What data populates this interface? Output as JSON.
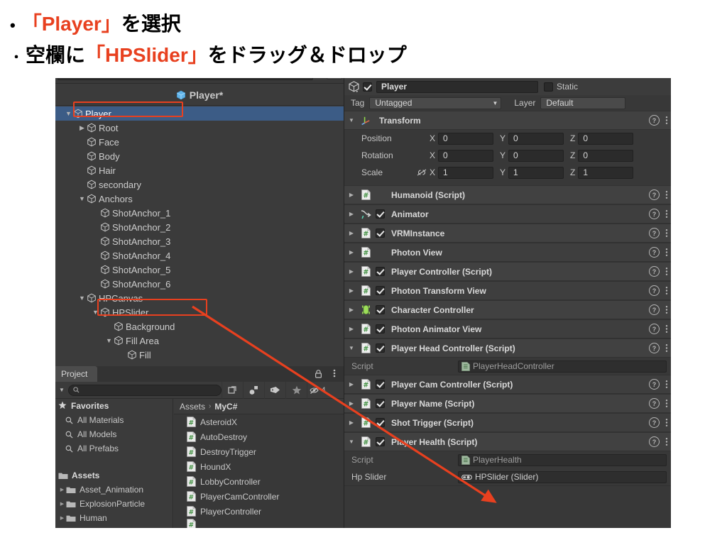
{
  "slide": {
    "line1": {
      "bullet": "•",
      "quote_open": "「",
      "highlight": "Player",
      "quote_close": "」",
      "rest": "を選択"
    },
    "line2": {
      "bullet": "・",
      "prefix": "空欄に",
      "quote_open": "「",
      "highlight": "HPSlider",
      "quote_close": "」",
      "rest": "をドラッグ＆ドロップ"
    },
    "highlight_color": "#e8401f",
    "text_color": "#000000"
  },
  "hierarchy": {
    "prefab_header": "Player*",
    "items": [
      {
        "label": "Player",
        "depth": 0,
        "twirl": "down",
        "selected": true
      },
      {
        "label": "Root",
        "depth": 1,
        "twirl": "right",
        "selected": false
      },
      {
        "label": "Face",
        "depth": 1,
        "twirl": "none",
        "selected": false
      },
      {
        "label": "Body",
        "depth": 1,
        "twirl": "none",
        "selected": false
      },
      {
        "label": "Hair",
        "depth": 1,
        "twirl": "none",
        "selected": false
      },
      {
        "label": "secondary",
        "depth": 1,
        "twirl": "none",
        "selected": false
      },
      {
        "label": "Anchors",
        "depth": 1,
        "twirl": "down",
        "selected": false
      },
      {
        "label": "ShotAnchor_1",
        "depth": 2,
        "twirl": "none",
        "selected": false
      },
      {
        "label": "ShotAnchor_2",
        "depth": 2,
        "twirl": "none",
        "selected": false
      },
      {
        "label": "ShotAnchor_3",
        "depth": 2,
        "twirl": "none",
        "selected": false
      },
      {
        "label": "ShotAnchor_4",
        "depth": 2,
        "twirl": "none",
        "selected": false
      },
      {
        "label": "ShotAnchor_5",
        "depth": 2,
        "twirl": "none",
        "selected": false
      },
      {
        "label": "ShotAnchor_6",
        "depth": 2,
        "twirl": "none",
        "selected": false
      },
      {
        "label": "HPCanvas",
        "depth": 1,
        "twirl": "down",
        "selected": false
      },
      {
        "label": "HPSlider",
        "depth": 2,
        "twirl": "down",
        "selected": false
      },
      {
        "label": "Background",
        "depth": 3,
        "twirl": "none",
        "selected": false
      },
      {
        "label": "Fill Area",
        "depth": 3,
        "twirl": "down",
        "selected": false
      },
      {
        "label": "Fill",
        "depth": 4,
        "twirl": "none",
        "selected": false
      }
    ],
    "selection_color": "#3c5c86"
  },
  "project": {
    "tab_label": "Project",
    "lock_icon": "lock-icon",
    "kebab_icon": "kebab-menu-icon",
    "search_placeholder": "",
    "search_value": "",
    "toolbar_icons": [
      "search-expand-icon",
      "asset-type-filter-icon",
      "label-filter-icon",
      "favorite-star-icon",
      "hidden-packages-icon"
    ],
    "toolbar_count": "4",
    "favorites": {
      "header": "Favorites",
      "items": [
        "All Materials",
        "All Models",
        "All Prefabs"
      ]
    },
    "assets": {
      "header": "Assets",
      "items": [
        "Asset_Animation",
        "ExplosionParticle",
        "Human"
      ]
    },
    "breadcrumb": {
      "root": "Assets",
      "sep": "›",
      "current": "MyC#"
    },
    "files": [
      "AsteroidX",
      "AutoDestroy",
      "DestroyTrigger",
      "HoundX",
      "LobbyController",
      "PlayerCamController",
      "PlayerController"
    ]
  },
  "inspector": {
    "object_name": "Player",
    "object_enabled": true,
    "static_label": "Static",
    "static_checked": false,
    "tag_label": "Tag",
    "tag_value": "Untagged",
    "layer_label": "Layer",
    "layer_value": "Default",
    "transform": {
      "title": "Transform",
      "rows": [
        {
          "label": "Position",
          "x": "0",
          "y": "0",
          "z": "0",
          "link": false
        },
        {
          "label": "Rotation",
          "x": "0",
          "y": "0",
          "z": "0",
          "link": false
        },
        {
          "label": "Scale",
          "x": "1",
          "y": "1",
          "z": "1",
          "link": true
        }
      ],
      "axes": [
        "X",
        "Y",
        "Z"
      ]
    },
    "components": [
      {
        "title": "Humanoid (Script)",
        "icon": "script-icon",
        "has_checkbox": false,
        "checked": false,
        "expanded": false
      },
      {
        "title": "Animator",
        "icon": "animator-icon",
        "has_checkbox": true,
        "checked": true,
        "expanded": false
      },
      {
        "title": "VRMInstance",
        "icon": "script-icon",
        "has_checkbox": true,
        "checked": true,
        "expanded": false
      },
      {
        "title": "Photon View",
        "icon": "script-icon",
        "has_checkbox": false,
        "checked": false,
        "expanded": false
      },
      {
        "title": "Player Controller (Script)",
        "icon": "script-icon",
        "has_checkbox": true,
        "checked": true,
        "expanded": false
      },
      {
        "title": "Photon Transform View",
        "icon": "script-icon",
        "has_checkbox": true,
        "checked": true,
        "expanded": false
      },
      {
        "title": "Character Controller",
        "icon": "capsule-icon",
        "has_checkbox": true,
        "checked": true,
        "expanded": false
      },
      {
        "title": "Photon Animator View",
        "icon": "script-icon",
        "has_checkbox": true,
        "checked": true,
        "expanded": false
      },
      {
        "title": "Player Head Controller (Script)",
        "icon": "script-icon",
        "has_checkbox": true,
        "checked": true,
        "expanded": true
      }
    ],
    "head_controller_fields": [
      {
        "label": "Script",
        "value": "PlayerHeadController",
        "icon": "script-asset-icon",
        "readonly": true
      }
    ],
    "components_tail": [
      {
        "title": "Player Cam Controller (Script)",
        "icon": "script-icon",
        "has_checkbox": true,
        "checked": true,
        "expanded": false
      },
      {
        "title": "Player Name (Script)",
        "icon": "script-icon",
        "has_checkbox": true,
        "checked": true,
        "expanded": false
      },
      {
        "title": "Shot Trigger (Script)",
        "icon": "script-icon",
        "has_checkbox": true,
        "checked": true,
        "expanded": false
      },
      {
        "title": "Player Health (Script)",
        "icon": "script-icon",
        "has_checkbox": true,
        "checked": true,
        "expanded": true
      }
    ],
    "health_fields": [
      {
        "label": "Script",
        "value": "PlayerHealth",
        "icon": "script-asset-icon",
        "readonly": true
      },
      {
        "label": "Hp Slider",
        "value": "HPSlider (Slider)",
        "icon": "slider-asset-icon",
        "readonly": false
      }
    ],
    "help_icon": "help-icon",
    "menu_icon": "kebab-menu-icon"
  },
  "annotations": {
    "color": "#e8401f",
    "box_player": "Player",
    "box_hpslider": "HPSlider",
    "arrow": "drag-drop-arrow"
  }
}
